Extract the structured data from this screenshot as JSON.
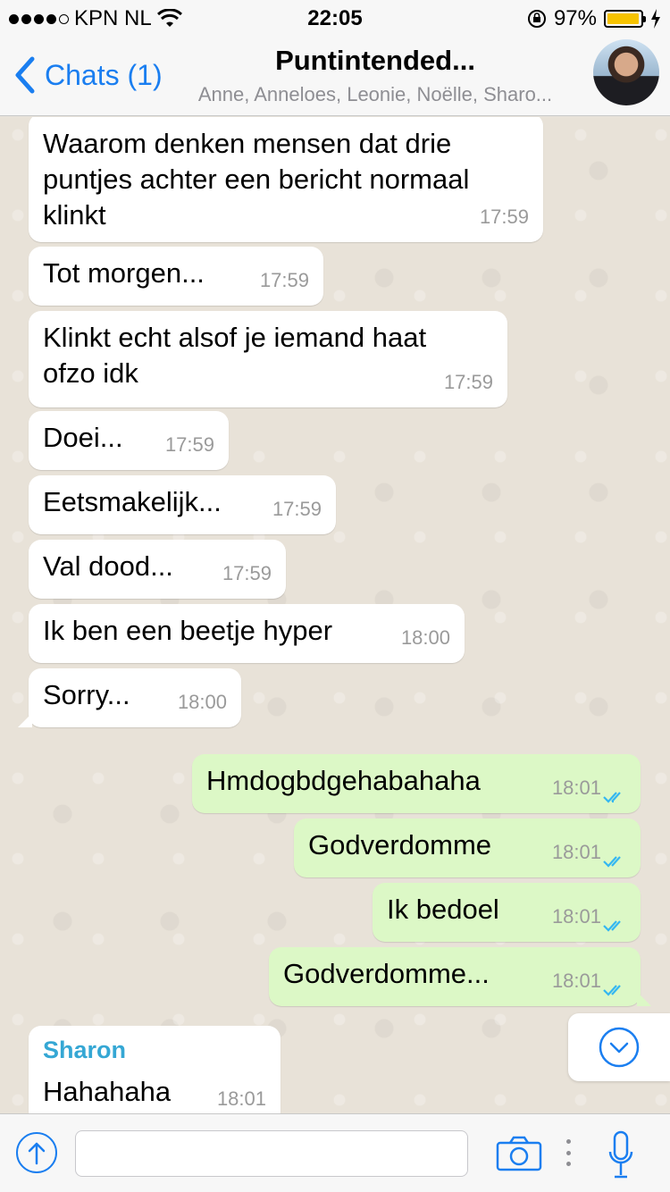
{
  "status_bar": {
    "carrier": "KPN NL",
    "time": "22:05",
    "battery": "97%",
    "battery_level": 0.97
  },
  "header": {
    "back_label": "Chats (1)",
    "title": "Puntintended...",
    "subtitle": "Anne, Anneloes, Leonie, Noëlle, Sharo..."
  },
  "messages": [
    {
      "text": "Waarom denken mensen dat drie puntjes achter een bericht normaal klinkt",
      "time": "17:59"
    },
    {
      "text": "Tot morgen...",
      "time": "17:59"
    },
    {
      "text": "Klinkt echt alsof je iemand haat ofzo idk",
      "time": "17:59"
    },
    {
      "text": "Doei...",
      "time": "17:59"
    },
    {
      "text": "Eetsmakelijk...",
      "time": "17:59"
    },
    {
      "text": "Val dood...",
      "time": "17:59"
    },
    {
      "text": "Ik ben een beetje hyper",
      "time": "18:00"
    },
    {
      "text": "Sorry...",
      "time": "18:00"
    },
    {
      "text": "Hmdogbdgehabahaha",
      "time": "18:01"
    },
    {
      "text": "Godverdomme",
      "time": "18:01"
    },
    {
      "text": "Ik bedoel",
      "time": "18:01"
    },
    {
      "text": "Godverdomme...",
      "time": "18:01"
    },
    {
      "sender": "Sharon",
      "text": "Hahahaha",
      "time": "18:01"
    }
  ],
  "input": {
    "placeholder": ""
  },
  "colors": {
    "accent": "#1a7ef0",
    "outgoing_bubble": "#dcf8c6",
    "incoming_bubble": "#ffffff",
    "sender_name": "#35a7d4",
    "read_ticks": "#34b7f1"
  },
  "icons": [
    "back-chevron-icon",
    "wifi-icon",
    "lock-rotation-icon",
    "battery-icon",
    "charging-icon",
    "read-receipt-icon",
    "scroll-down-icon",
    "upload-icon",
    "camera-icon",
    "more-icon",
    "microphone-icon"
  ]
}
